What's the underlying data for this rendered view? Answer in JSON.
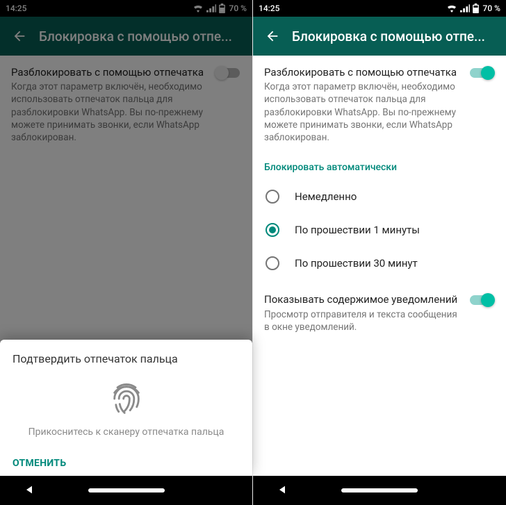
{
  "status": {
    "time": "14:25",
    "battery_pct": "70 %"
  },
  "appbar": {
    "title": "Блокировка с помощью отпе..."
  },
  "unlock": {
    "title": "Разблокировать с помощью отпечатка",
    "desc": "Когда этот параметр включён, необходимо использовать отпечаток пальца для разблокировки WhatsApp. Вы по-прежнему можете принимать звонки, если WhatsApp заблокирован."
  },
  "auto_lock": {
    "header": "Блокировать автоматически",
    "options": [
      "Немедленно",
      "По прошествии 1 минуты",
      "По прошествии 30 минут"
    ],
    "selected_index": 1
  },
  "notif": {
    "title": "Показывать содержимое уведомлений",
    "desc": "Просмотр отправителя и текста сообщения в окне уведомлений."
  },
  "dialog": {
    "title": "Подтвердить отпечаток пальца",
    "hint": "Прикоснитесь к сканеру отпечатка пальца",
    "cancel": "ОТМЕНИТЬ"
  },
  "colors": {
    "accent": "#00897b",
    "appbar": "#075E54"
  }
}
